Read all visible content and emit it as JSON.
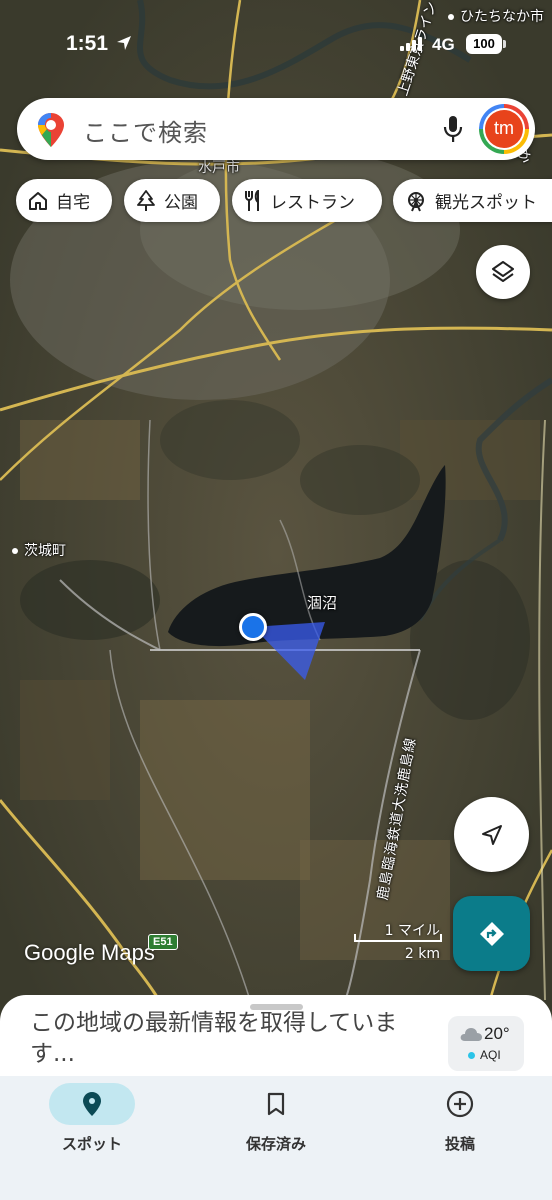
{
  "status_bar": {
    "time": "1:51",
    "network": "4G",
    "battery": "100"
  },
  "search": {
    "placeholder": "ここで検索",
    "avatar_initials": "tm",
    "icons": [
      "google-maps-pin-icon",
      "mic-icon"
    ]
  },
  "chips": [
    {
      "label": "自宅",
      "icon": "home-icon"
    },
    {
      "label": "公園",
      "icon": "tree-icon"
    },
    {
      "label": "レストラン",
      "icon": "fork-knife-icon"
    },
    {
      "label": "観光スポット",
      "icon": "ferris-wheel-icon"
    }
  ],
  "map": {
    "labels": {
      "top_poi": "ひたちなか市",
      "city_top": "水戸市",
      "lake": "涸沼",
      "town_left": "茨城町",
      "railway": "鹿島臨海鉄道大洗鹿島線",
      "top_right_edge": "なか",
      "top_vertical": "上野東京ライン"
    },
    "logo": "Google Maps",
    "highway_shield": "E51",
    "scale": {
      "imperial": "1 マイル",
      "metric": "2 km"
    },
    "colors": {
      "my_location": "#1a73e8",
      "directions_button": "#0b7c8a"
    }
  },
  "sheet": {
    "message": "この地域の最新情報を取得しています...",
    "weather": {
      "temperature": "20°",
      "aqi_label": "AQI"
    }
  },
  "nav": [
    {
      "label": "スポット",
      "icon": "location-pin-icon",
      "active": true
    },
    {
      "label": "保存済み",
      "icon": "bookmark-icon",
      "active": false
    },
    {
      "label": "投稿",
      "icon": "add-circle-icon",
      "active": false
    }
  ]
}
